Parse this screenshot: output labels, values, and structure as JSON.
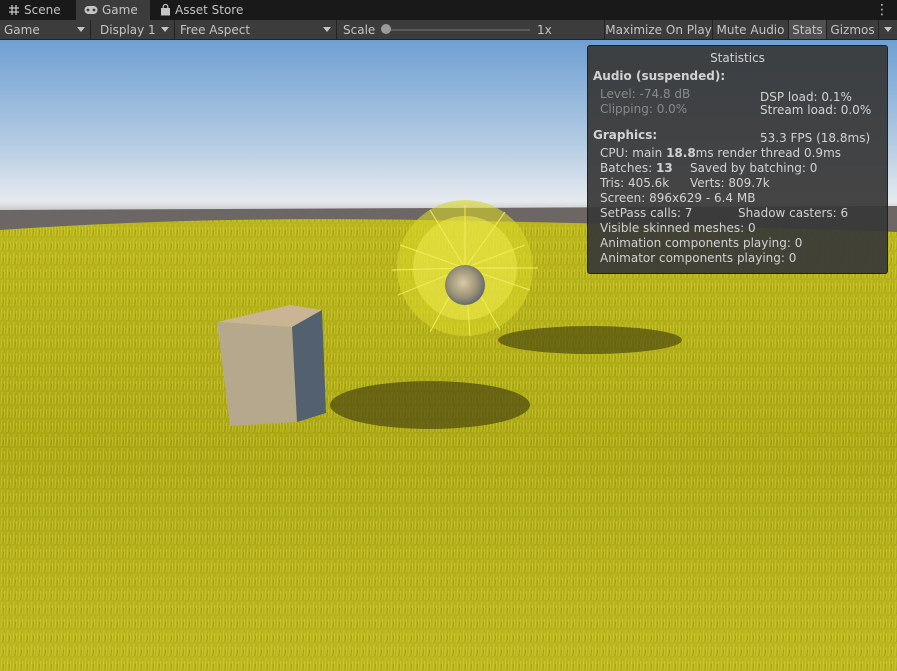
{
  "tabs": [
    {
      "label": "Scene",
      "icon": "grid-hash-icon"
    },
    {
      "label": "Game",
      "icon": "gamepad-icon"
    },
    {
      "label": "Asset Store",
      "icon": "shopping-bag-icon"
    }
  ],
  "toolbar": {
    "view_mode": "Game",
    "display": "Display 1",
    "aspect": "Free Aspect",
    "scale_label": "Scale",
    "scale_value": "1x",
    "maximize_on_play": "Maximize On Play",
    "mute_audio": "Mute Audio",
    "stats": "Stats",
    "gizmos": "Gizmos"
  },
  "stats": {
    "title": "Statistics",
    "audio_header": "Audio (suspended):",
    "level": "Level: -74.8 dB",
    "clipping": "Clipping: 0.0%",
    "dsp_load": "DSP load: 0.1%",
    "stream_load": "Stream load: 0.0%",
    "graphics_header": "Graphics:",
    "fps": "53.3 FPS (18.8ms)",
    "cpu_prefix": "CPU: main ",
    "cpu_main": "18.8",
    "cpu_suffix": "ms  render thread 0.9ms",
    "batches_prefix": "Batches: ",
    "batches": "13",
    "saved_by_batching": "Saved by batching: 0",
    "tris": "Tris: 405.6k",
    "verts": "Verts: 809.7k",
    "screen": "Screen: 896x629 - 6.4 MB",
    "setpass": "SetPass calls: 7",
    "shadow_casters": "Shadow casters: 6",
    "skinned_meshes": "Visible skinned meshes: 0",
    "animation_components": "Animation components playing: 0",
    "animator_components": "Animator components playing: 0"
  },
  "colors": {
    "sky_top": "#6f9fd2",
    "horizon": "#e6eaee",
    "grass": "#b3b118",
    "grass_light": "#e4e23a",
    "cube_top": "#c9b494",
    "cube_front": "#b6a88c",
    "cube_side": "#53606f"
  }
}
